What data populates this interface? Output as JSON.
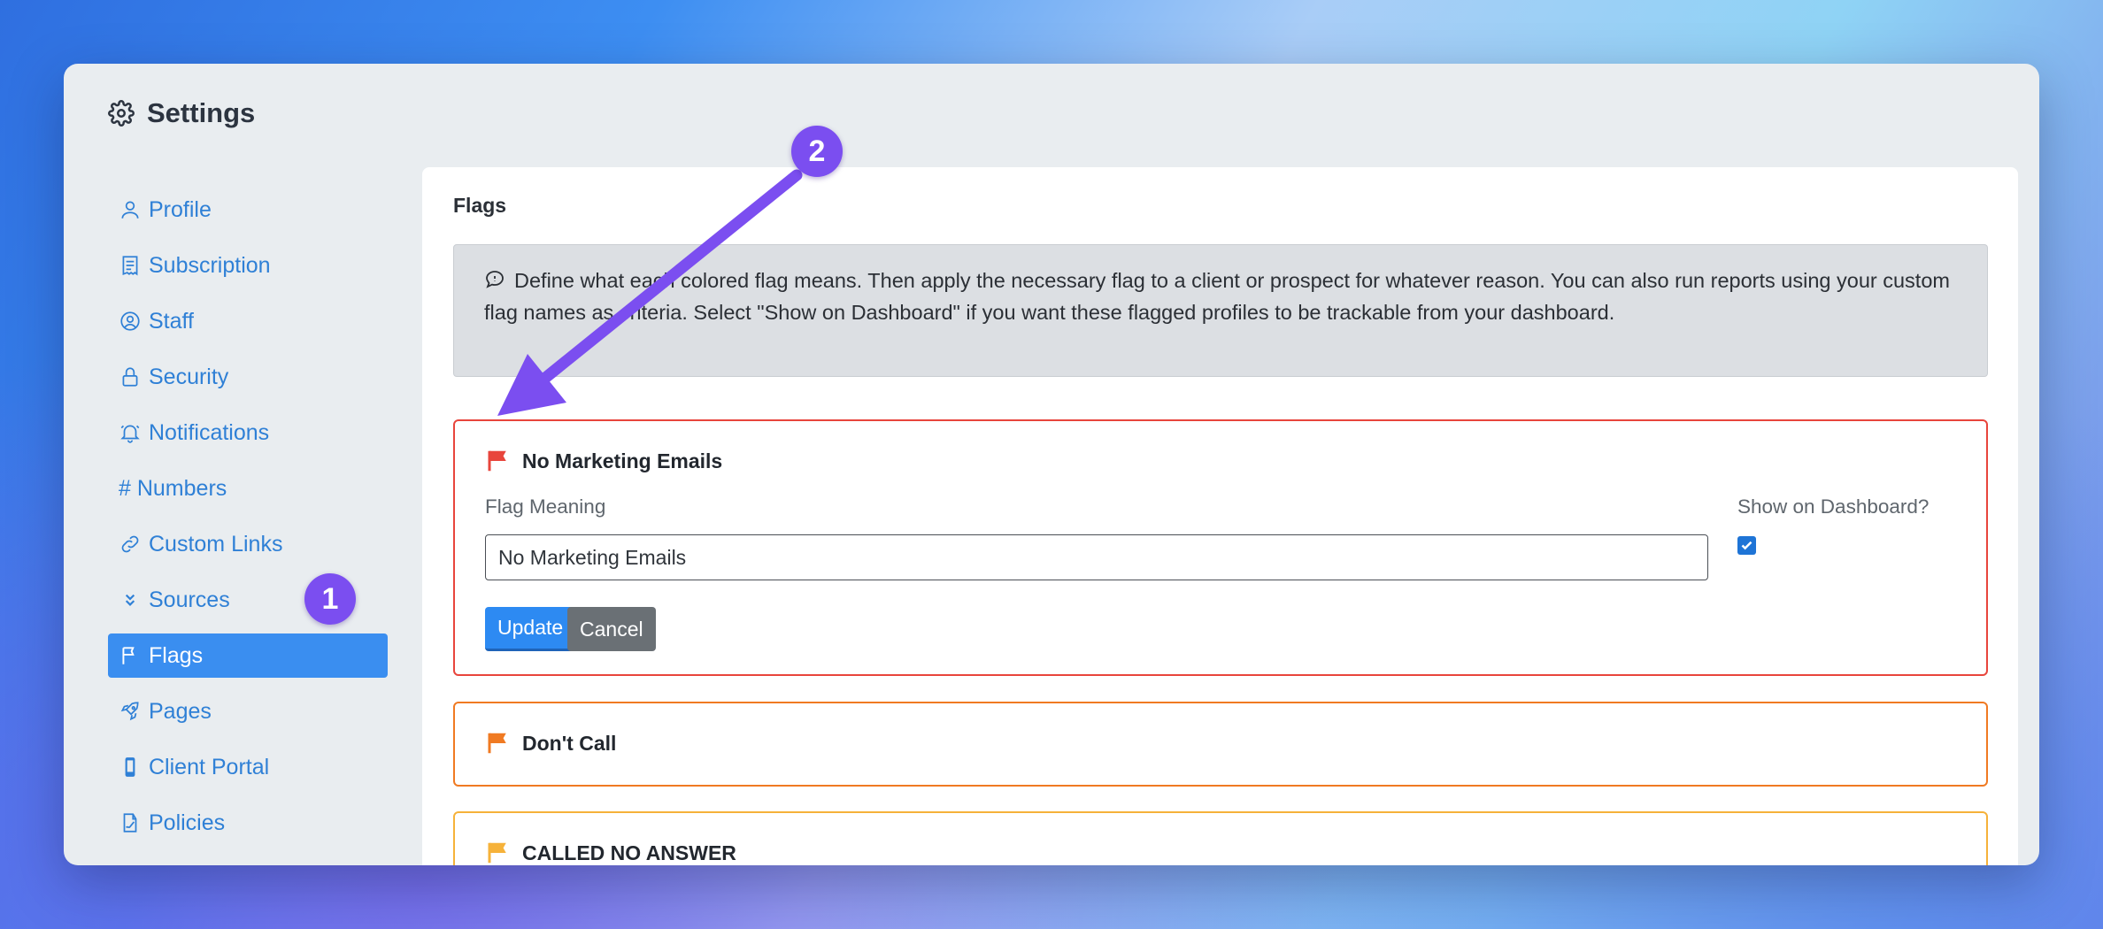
{
  "window": {
    "title": "Settings"
  },
  "sidebar": {
    "items": [
      {
        "label": "Profile",
        "icon": "user-icon"
      },
      {
        "label": "Subscription",
        "icon": "receipt-icon"
      },
      {
        "label": "Staff",
        "icon": "user-circle-icon"
      },
      {
        "label": "Security",
        "icon": "lock-icon"
      },
      {
        "label": "Notifications",
        "icon": "bell-icon"
      },
      {
        "label": "# Numbers",
        "icon": "hash-icon"
      },
      {
        "label": "Custom Links",
        "icon": "link-icon"
      },
      {
        "label": "Sources",
        "icon": "chevrons-down-icon"
      },
      {
        "label": "Flags",
        "icon": "flag-icon",
        "active": true
      },
      {
        "label": "Pages",
        "icon": "rocket-icon"
      },
      {
        "label": "Client Portal",
        "icon": "phone-icon"
      },
      {
        "label": "Policies",
        "icon": "file-signature-icon"
      }
    ]
  },
  "annotations": {
    "badge1": "1",
    "badge2": "2"
  },
  "main": {
    "title": "Flags",
    "info": "Define what each colored flag means. Then apply the necessary flag to a client or prospect for whatever reason. You can also run reports using your custom flag names as criteria. Select \"Show on Dashboard\" if you want these flagged profiles to be trackable from your dashboard.",
    "flags": [
      {
        "name": "No Marketing Emails",
        "color": "#e8453c",
        "meaning_label": "Flag Meaning",
        "meaning_value": "No Marketing Emails",
        "dashboard_label": "Show on Dashboard?",
        "dashboard_checked": true,
        "update_label": "Update",
        "cancel_label": "Cancel"
      },
      {
        "name": "Don't Call",
        "color": "#f07a22"
      },
      {
        "name": "CALLED NO ANSWER",
        "color": "#f6b23a"
      }
    ]
  },
  "colors": {
    "accent": "#3a8ef0",
    "badge": "#7b4ef0",
    "arrow": "#7b4ef0"
  }
}
